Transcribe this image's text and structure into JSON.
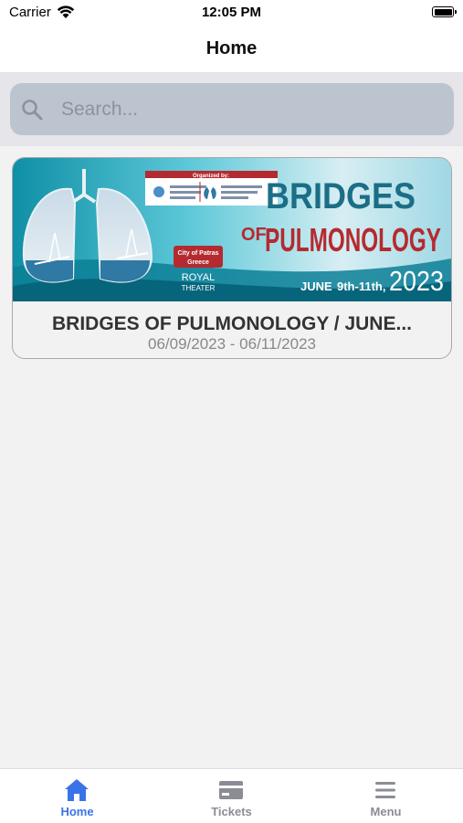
{
  "status_bar": {
    "carrier": "Carrier",
    "time": "12:05 PM"
  },
  "nav": {
    "title": "Home"
  },
  "search": {
    "placeholder": "Search..."
  },
  "events": [
    {
      "title": "BRIDGES OF PULMONOLOGY / JUNE...",
      "dates": "06/09/2023 - 06/11/2023",
      "banner": {
        "organized_by": "Organized by:",
        "heading_line1": "BRIDGES",
        "heading_of": "OF",
        "heading_line2": "PULMONOLOGY",
        "city_line1": "City of Patras",
        "city_line2": "Greece",
        "venue_line1": "ROYAL",
        "venue_line2": "THEATER",
        "date_prefix": "JUNE",
        "date_range": "9th-11th,",
        "year": "2023"
      }
    }
  ],
  "tabs": [
    {
      "label": "Home",
      "icon": "home-icon",
      "active": true
    },
    {
      "label": "Tickets",
      "icon": "ticket-icon",
      "active": false
    },
    {
      "label": "Menu",
      "icon": "menu-icon",
      "active": false
    }
  ],
  "colors": {
    "accent": "#3a73e8",
    "inactive_tab": "#8a8d94",
    "search_bg": "#bcc4cf",
    "banner_red": "#b52a2f",
    "banner_teal": "#1c6e86"
  }
}
